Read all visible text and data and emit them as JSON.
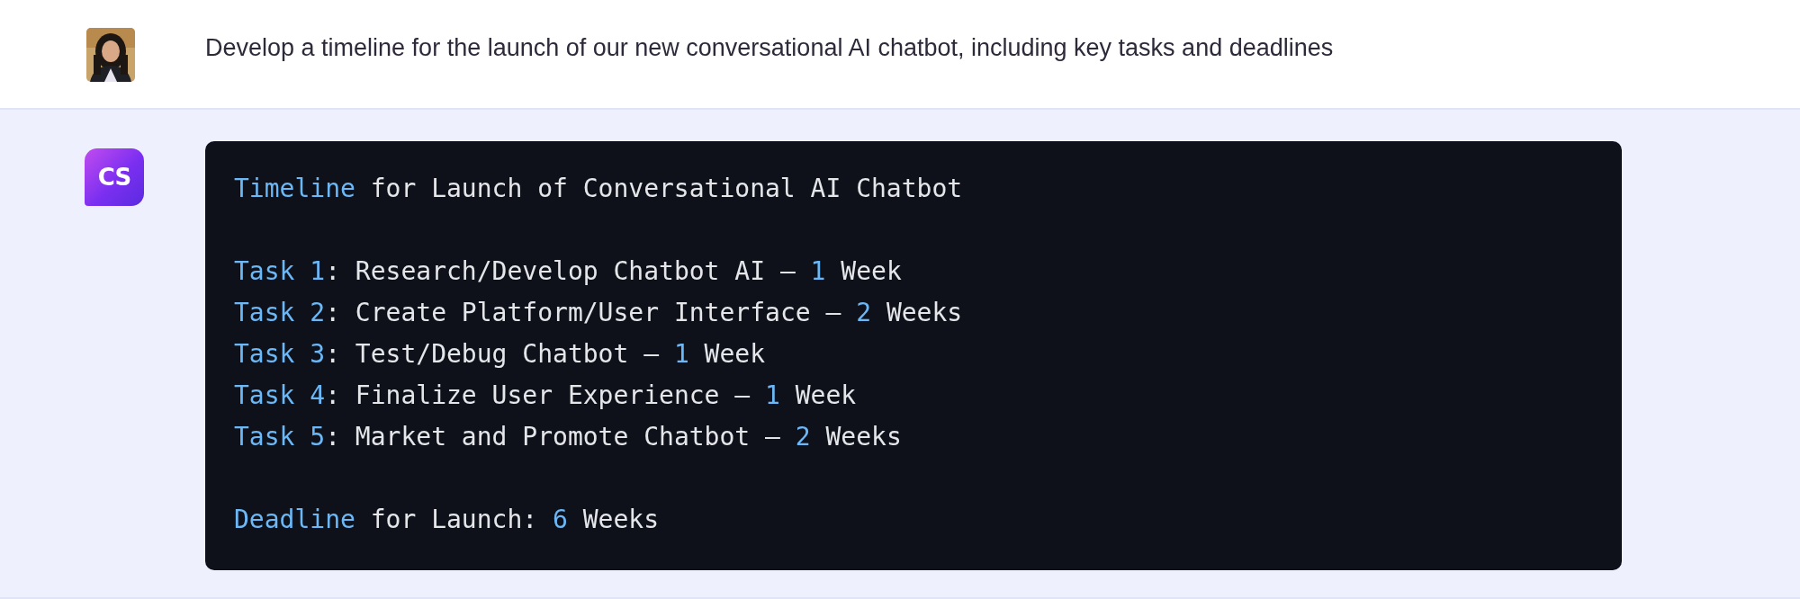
{
  "user_message": {
    "text": "Develop a timeline for the launch of our new conversational AI chatbot, including key tasks and deadlines"
  },
  "assistant_message": {
    "logo_text": "CS",
    "code_block": {
      "paragraphs": [
        [
          [
            {
              "text": "Timeline",
              "kind": "keyword"
            },
            {
              "text": " for Launch of Conversational AI Chatbot",
              "kind": "plain"
            }
          ]
        ],
        [
          [
            {
              "text": "Task 1",
              "kind": "keyword"
            },
            {
              "text": ": Research/Develop Chatbot AI – ",
              "kind": "plain"
            },
            {
              "text": "1",
              "kind": "keyword"
            },
            {
              "text": " Week",
              "kind": "plain"
            }
          ],
          [
            {
              "text": "Task 2",
              "kind": "keyword"
            },
            {
              "text": ": Create Platform/User Interface – ",
              "kind": "plain"
            },
            {
              "text": "2",
              "kind": "keyword"
            },
            {
              "text": " Weeks",
              "kind": "plain"
            }
          ],
          [
            {
              "text": "Task 3",
              "kind": "keyword"
            },
            {
              "text": ": Test/Debug Chatbot – ",
              "kind": "plain"
            },
            {
              "text": "1",
              "kind": "keyword"
            },
            {
              "text": " Week",
              "kind": "plain"
            }
          ],
          [
            {
              "text": "Task 4",
              "kind": "keyword"
            },
            {
              "text": ": Finalize User Experience – ",
              "kind": "plain"
            },
            {
              "text": "1",
              "kind": "keyword"
            },
            {
              "text": " Week",
              "kind": "plain"
            }
          ],
          [
            {
              "text": "Task 5",
              "kind": "keyword"
            },
            {
              "text": ": Market and Promote Chatbot – ",
              "kind": "plain"
            },
            {
              "text": "2",
              "kind": "keyword"
            },
            {
              "text": " Weeks",
              "kind": "plain"
            }
          ]
        ],
        [
          [
            {
              "text": "Deadline",
              "kind": "keyword"
            },
            {
              "text": " for Launch: ",
              "kind": "plain"
            },
            {
              "text": "6",
              "kind": "keyword"
            },
            {
              "text": " Weeks",
              "kind": "plain"
            }
          ]
        ]
      ]
    }
  }
}
